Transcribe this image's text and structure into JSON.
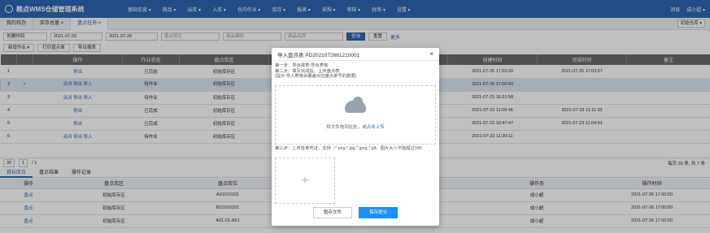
{
  "app": {
    "title": "粮点WMS仓储管理系统"
  },
  "nav": [
    "基础信息 ▾",
    "商品 ▾",
    "出库 ▾",
    "入库 ▾",
    "仓内作业 ▾",
    "库存 ▾",
    "报表 ▾",
    "采购 ▾",
    "审核 ▾",
    "财务 ▾",
    "设置 ▾"
  ],
  "topright": {
    "message": "消息",
    "user": "成小超 ▾"
  },
  "tabs": [
    {
      "label": "我的待办"
    },
    {
      "label": "库存总量 ×"
    },
    {
      "label": "盘点任务 ×"
    }
  ],
  "warehouse": {
    "value": "初始仓库 ▾"
  },
  "filters": {
    "date_type": "创建时间",
    "date_from": "2021-07-20",
    "date_to": "2021-07-26",
    "loc_placeholder": "盘点库位",
    "code_placeholder": "商品编码",
    "name_placeholder": "商品名称",
    "query_label": "查询",
    "reset_label": "重置",
    "more_label": "更多"
  },
  "toolbar": {
    "new_label": "新增作业 ▾",
    "print_label": "打印盘点单",
    "export_label": "导出报表"
  },
  "grid": {
    "headers": [
      "",
      "",
      "操作",
      "作业状态",
      "盘点库区",
      "盘点单号",
      "创建人",
      "创建时间",
      "完结时间",
      "备注"
    ],
    "rows": [
      [
        "1",
        "",
        "导出",
        "已完结",
        "初始库存区",
        "盘",
        "成小超",
        "2021-07-26 17:03:26",
        "2021-07-26 17:03:57",
        ""
      ],
      [
        "2",
        "✓",
        "关闭 导出 导入",
        "待作业",
        "初始库存区",
        "盘",
        "成小超",
        "2021-07-26 17:00:50",
        "",
        ""
      ],
      [
        "3",
        "",
        "关闭 导出 导入",
        "待作业",
        "初始库存区",
        "盘",
        "成小超",
        "2021-07-23 16:31:58",
        "",
        ""
      ],
      [
        "4",
        "",
        "导出",
        "已完成",
        "初始库存区",
        "盘",
        "成小超",
        "2021-07-23 11:09:46",
        "2021-07-23 11:11:33",
        ""
      ],
      [
        "5",
        "",
        "导出",
        "已完成",
        "初始库存区",
        "盘",
        "成小超",
        "2021-07-23 10:47:47",
        "2021-07-23 11:04:51",
        ""
      ],
      [
        "6",
        "",
        "关闭 导出 导入",
        "待作业",
        "初始库存区",
        "盘",
        "成小超",
        "2021-07-22 11:30:11",
        "",
        ""
      ]
    ]
  },
  "pager": {
    "size": "30",
    "page": "1",
    "total": "/ 1",
    "info": "每页 30 条, 共 7 条"
  },
  "subtabs": [
    "目标库位",
    "盘点结果",
    "操作记录"
  ],
  "sub_grid": {
    "headers": [
      "操作",
      "盘点库区",
      "盘点库位",
      "",
      "盘点数",
      "操作员",
      "操作时间"
    ],
    "rows": [
      [
        "盘点",
        "初始库存区",
        "A01010101",
        "",
        "0",
        "成小超",
        "2021-07-26 17:00:50"
      ],
      [
        "盘点",
        "初始库存区",
        "B01010101",
        "",
        "0",
        "成小超",
        "2021-07-26 17:00:50"
      ],
      [
        "盘点",
        "初始库存区",
        "A01-01-A01",
        "",
        "0",
        "成小超",
        "2021-07-26 17:00:50"
      ]
    ]
  },
  "modal": {
    "title": "导入盘点表 PD2021072661210001",
    "close": "×",
    "step1": "第一步：导出报表-导出表格",
    "step2": "第二步：填写完成后，上传盘点表",
    "hint": "(提示:导入表格会覆盖对应盘点单号的数据)",
    "drop_text": "将文件拖到此处，或",
    "drop_link": "点击上传",
    "step3": "第三步：上传签单凭证，支持（*.png,*.jpg,*.jpeg,*.gif，图片大小不能超过1M）",
    "plus": "+",
    "cancel_label": "暂存文件",
    "submit_label": "保存提交"
  }
}
